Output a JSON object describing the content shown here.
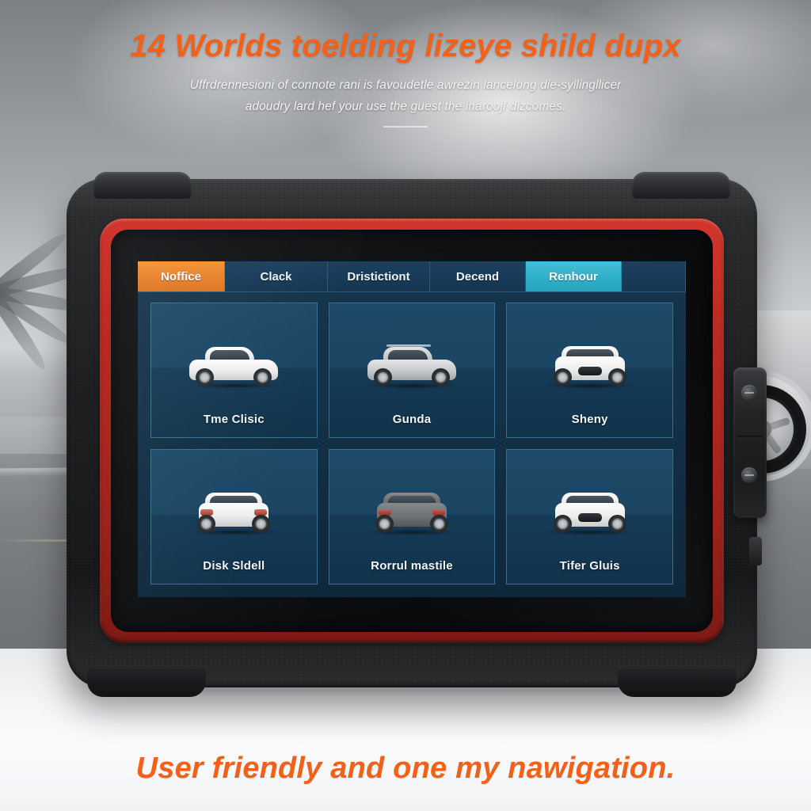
{
  "header": {
    "headline": "14 Worlds toelding lizeye shild dupx",
    "subline_1": "Uffrdrennesioni of connote rani is favoudetle awrezin lancelong die-syllingllicer",
    "subline_2": "adoudry lard hef your use the guest the inaroojf dizcomes."
  },
  "footer": {
    "caption": "User friendly and one my nawigation."
  },
  "device": {
    "name": "automotive-diagnostic-tablet",
    "shell_color": "#1e1f21",
    "bezel_color": "#bc2b22"
  },
  "screen": {
    "background_color": "#123048",
    "tabs": [
      {
        "label": "Noffice",
        "state": "active",
        "accent": "#e8812a"
      },
      {
        "label": "Clack",
        "state": "inactive",
        "accent": "#1b4060"
      },
      {
        "label": "Dristictiont",
        "state": "inactive",
        "accent": "#1b4060"
      },
      {
        "label": "Decend",
        "state": "inactive",
        "accent": "#1b4060"
      },
      {
        "label": "Renhour",
        "state": "selected",
        "accent": "#2fb0ca"
      },
      {
        "label": "",
        "state": "empty",
        "accent": "#1b4060"
      }
    ],
    "cards": [
      {
        "label": "Tme Clisic",
        "vehicle_color": "#fdfdfd",
        "view": "side"
      },
      {
        "label": "Gunda",
        "vehicle_color": "#c7cacd",
        "view": "side"
      },
      {
        "label": "Sheny",
        "vehicle_color": "#fdfdfd",
        "view": "front"
      },
      {
        "label": "Disk Sldell",
        "vehicle_color": "#fdfdfd",
        "view": "rear"
      },
      {
        "label": "Rorrul mastile",
        "vehicle_color": "#6e7275",
        "view": "rear"
      },
      {
        "label": "Tifer Gluis",
        "vehicle_color": "#fdfdfd",
        "view": "front"
      }
    ]
  },
  "background": {
    "scene": "coastal-road-with-parked-car",
    "sky_color": "#8e9194",
    "road_color": "#7e8184",
    "floor_color": "#f4f5f6"
  }
}
